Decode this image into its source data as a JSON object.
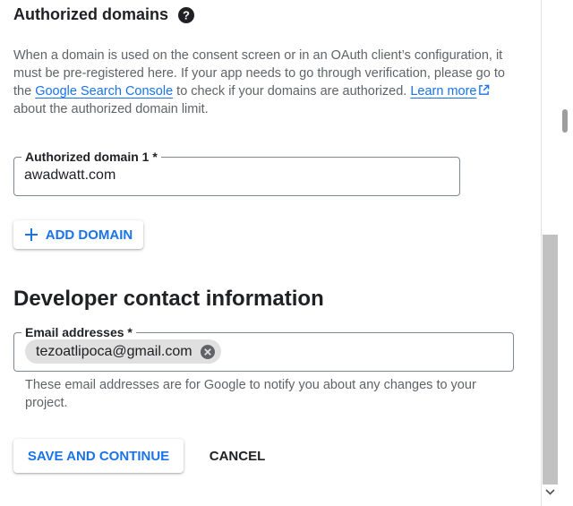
{
  "authorized_domains": {
    "title": "Authorized domains",
    "description_parts": {
      "text1": "When a domain is used on the consent screen or in an OAuth client’s configuration, it must be pre-registered here. If your app needs to go through verification, please go to the ",
      "link_console": "Google Search Console",
      "text2": " to check if your domains are authorized. ",
      "link_learn_more": "Learn more",
      "text3": " about the authorized domain limit."
    },
    "domain_field": {
      "label": "Authorized domain 1 *",
      "value": "awadwatt.com"
    },
    "add_domain_label": "ADD DOMAIN"
  },
  "developer_contact": {
    "title": "Developer contact information",
    "email_field": {
      "label": "Email addresses *",
      "chip": "tezoatlipoca@gmail.com"
    },
    "hint": "These email addresses are for Google to notify you about any changes to your project."
  },
  "actions": {
    "save_label": "SAVE AND CONTINUE",
    "cancel_label": "CANCEL"
  },
  "icons": {
    "help": "help-icon",
    "external_link": "external-link-icon",
    "plus": "plus-icon",
    "chip_remove": "cancel-circle-icon",
    "scroll_down": "chevron-down-icon"
  },
  "colors": {
    "accent": "#1a73e8",
    "text": "#202124",
    "secondary_text": "#5f6368"
  }
}
